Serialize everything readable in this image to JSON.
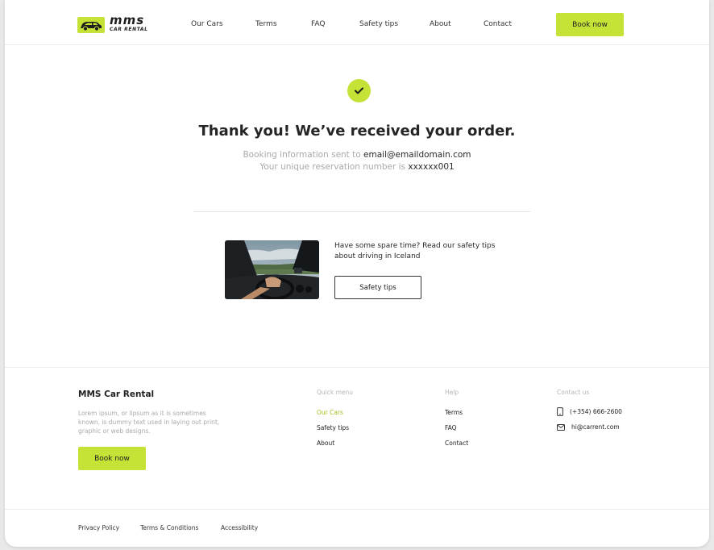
{
  "header": {
    "logo_text": "mms",
    "logo_sub": "CAR RENTAL",
    "nav": [
      "Our Cars",
      "Terms",
      "FAQ",
      "Safety tips",
      "About",
      "Contact"
    ],
    "book_label": "Book now"
  },
  "confirmation": {
    "title": "Thank you! We’ve received your order.",
    "info_prefix": "Booking information sent to ",
    "email": "email@emaildomain.com",
    "reservation_prefix": "Your unique reservation number is ",
    "reservation_number": "xxxxxx001"
  },
  "promo": {
    "text": "Have some spare time? Read our safety tips about driving in Iceland",
    "button_label": "Safety tips"
  },
  "footer": {
    "brand": "MMS Car Rental",
    "description": "Lorem ipsum, or lipsum as it is sometimes known, is dummy text used in laying out print, graphic or web designs.",
    "book_label": "Book now",
    "quick_menu": {
      "title": "Quick menu",
      "links": [
        "Our Cars",
        "Safety tips",
        "About"
      ]
    },
    "help": {
      "title": "Help",
      "links": [
        "Terms",
        "FAQ",
        "Contact"
      ]
    },
    "contact": {
      "title": "Contact us",
      "phone": "(+354) 666-2600",
      "email": "hi@carrent.com"
    },
    "bottom_links": [
      "Privacy Policy",
      "Terms & Conditions",
      "Accessibility"
    ]
  },
  "colors": {
    "accent": "#c5e237",
    "accent_text": "#9fc21c",
    "muted": "#a9a9a9"
  }
}
